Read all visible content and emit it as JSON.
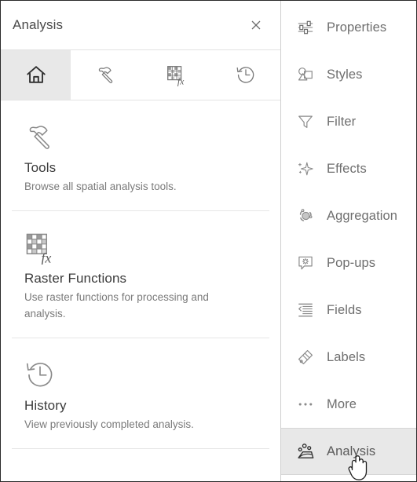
{
  "panel": {
    "title": "Analysis",
    "close_icon": "close-icon"
  },
  "tabs": [
    {
      "id": "home",
      "icon": "home-icon",
      "active": true
    },
    {
      "id": "tools",
      "icon": "hammer-icon",
      "active": false
    },
    {
      "id": "raster",
      "icon": "raster-function-icon",
      "active": false
    },
    {
      "id": "history",
      "icon": "history-clock-icon",
      "active": false
    }
  ],
  "cards": [
    {
      "icon": "hammer-icon",
      "title": "Tools",
      "desc": "Browse all spatial analysis tools."
    },
    {
      "icon": "raster-function-icon",
      "title": "Raster Functions",
      "desc": "Use raster functions for processing and analysis."
    },
    {
      "icon": "history-clock-icon",
      "title": "History",
      "desc": "View previously completed analysis."
    }
  ],
  "sidebar": {
    "items": [
      {
        "label": "Properties",
        "icon": "sliders-icon",
        "active": false
      },
      {
        "label": "Styles",
        "icon": "styles-icon",
        "active": false
      },
      {
        "label": "Filter",
        "icon": "funnel-icon",
        "active": false
      },
      {
        "label": "Effects",
        "icon": "sparkle-icon",
        "active": false
      },
      {
        "label": "Aggregation",
        "icon": "aggregation-icon",
        "active": false
      },
      {
        "label": "Pop-ups",
        "icon": "popup-gear-icon",
        "active": false
      },
      {
        "label": "Fields",
        "icon": "fields-icon",
        "active": false
      },
      {
        "label": "Labels",
        "icon": "label-tag-icon",
        "active": false
      },
      {
        "label": "More",
        "icon": "ellipsis-icon",
        "active": false
      },
      {
        "label": "Analysis",
        "icon": "analysis-icon",
        "active": true
      }
    ]
  },
  "cursor": {
    "icon": "hand-pointer-cursor"
  },
  "colors": {
    "panel_bg": "#ffffff",
    "active_tab_bg": "#e8e8e8",
    "active_item_bg": "#e8e8e8",
    "title_text": "#4a4a4a",
    "label_text": "#6e6e6e",
    "desc_text": "#7a7a7a",
    "divider": "#e6e6e6",
    "icon_stroke": "#6b6b6b"
  }
}
